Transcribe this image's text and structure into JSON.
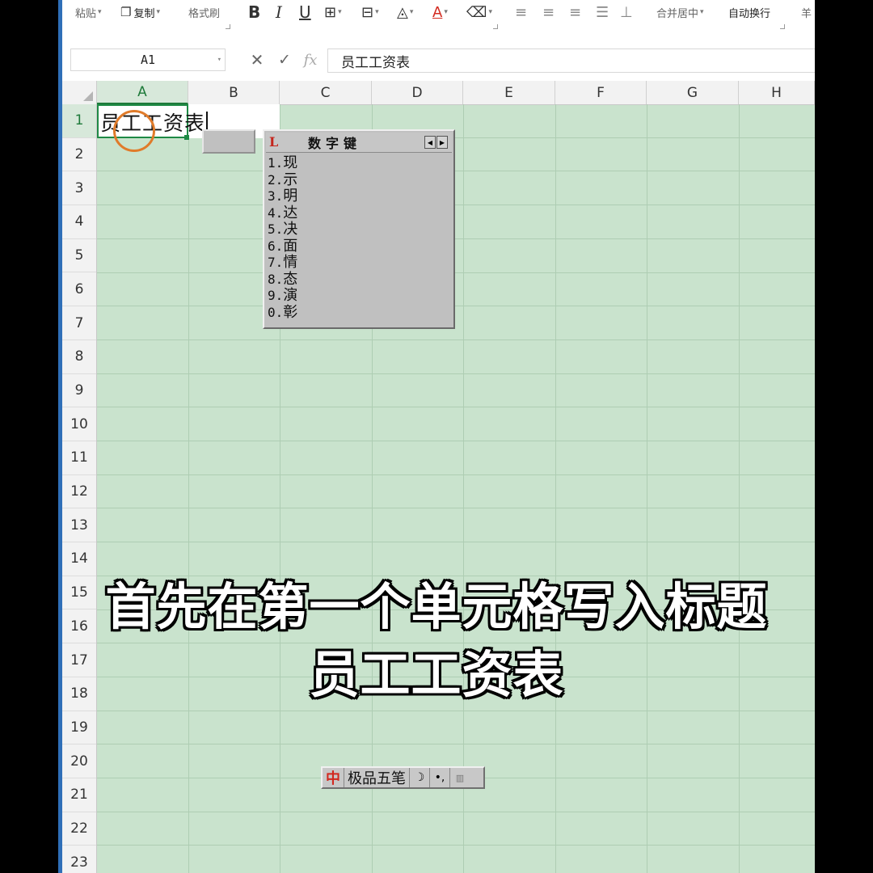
{
  "toolbar": {
    "paste": "粘贴",
    "copy": "复制",
    "format_painter": "格式刷",
    "bold": "B",
    "italic": "I",
    "underline": "U",
    "merge_center": "合并居中",
    "wrap_text": "自动换行",
    "truncated": "羊"
  },
  "formula_bar": {
    "cell_ref": "A1",
    "cancel": "✕",
    "confirm": "✓",
    "fx": "fx",
    "content": "员工工资表"
  },
  "columns": [
    "A",
    "B",
    "C",
    "D",
    "E",
    "F",
    "G",
    "H"
  ],
  "rows": [
    "1",
    "2",
    "3",
    "4",
    "5",
    "6",
    "7",
    "8",
    "9",
    "10",
    "11",
    "12",
    "13",
    "14",
    "15",
    "16",
    "17",
    "18",
    "19",
    "20",
    "21",
    "22",
    "23"
  ],
  "active_cell": {
    "text": "员工工资表"
  },
  "ime_candidates": {
    "title": "数字键",
    "items": [
      {
        "num": "1.",
        "char": "现"
      },
      {
        "num": "2.",
        "char": "示"
      },
      {
        "num": "3.",
        "char": "明"
      },
      {
        "num": "4.",
        "char": "达"
      },
      {
        "num": "5.",
        "char": "决"
      },
      {
        "num": "6.",
        "char": "面"
      },
      {
        "num": "7.",
        "char": "情"
      },
      {
        "num": "8.",
        "char": "态"
      },
      {
        "num": "9.",
        "char": "演"
      },
      {
        "num": "0.",
        "char": "彰"
      }
    ]
  },
  "ime_status": {
    "mode": "中",
    "name": "极品五笔",
    "moon": "☽",
    "punct": "•,",
    "kbd": "▥"
  },
  "subtitles": {
    "line1": "首先在第一个单元格写入标题",
    "line2": "员工工资表"
  },
  "colors": {
    "sheet_bg": "#c9e3cd",
    "active_border": "#1e8a45",
    "cursor_ring": "#e07b2a"
  }
}
